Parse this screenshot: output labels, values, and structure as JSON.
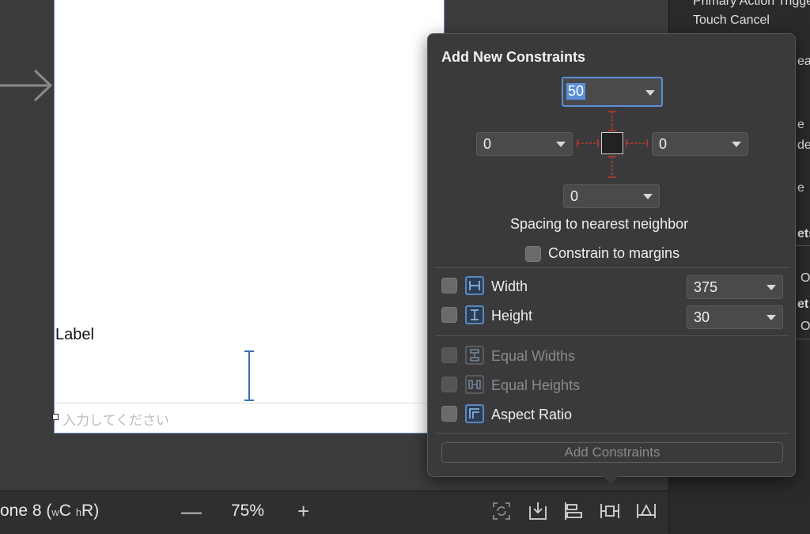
{
  "canvas": {
    "label_text": "Label",
    "textfield_placeholder": "入力してください"
  },
  "inspector": {
    "items": [
      "Primary Action Triggered",
      "Touch Cancel"
    ],
    "fragments": [
      "ea",
      "e",
      "de",
      "e",
      "ets",
      "O",
      "et",
      "O"
    ]
  },
  "bottom_bar": {
    "device": "one 8",
    "size_class_w": "w",
    "size_class_w_val": "C",
    "size_class_h": "h",
    "size_class_h_val": "R",
    "zoom_out": "—",
    "zoom_level": "75%",
    "zoom_in": "+"
  },
  "popover": {
    "title": "Add New Constraints",
    "top_value": "50",
    "left_value": "0",
    "right_value": "0",
    "bottom_value": "0",
    "spacing_label": "Spacing to nearest neighbor",
    "constrain_margins": "Constrain to margins",
    "width_label": "Width",
    "width_value": "375",
    "height_label": "Height",
    "height_value": "30",
    "equal_widths": "Equal Widths",
    "equal_heights": "Equal Heights",
    "aspect_ratio": "Aspect Ratio",
    "add_button": "Add Constraints"
  },
  "colors": {
    "accent": "#5b8fd6",
    "strut": "#c0392b",
    "popover_bg": "#3a3a3c"
  },
  "icons": {
    "tools": [
      "update-frames-icon",
      "embed-in-icon",
      "align-icon",
      "add-constraints-icon",
      "resolve-issues-icon"
    ]
  }
}
